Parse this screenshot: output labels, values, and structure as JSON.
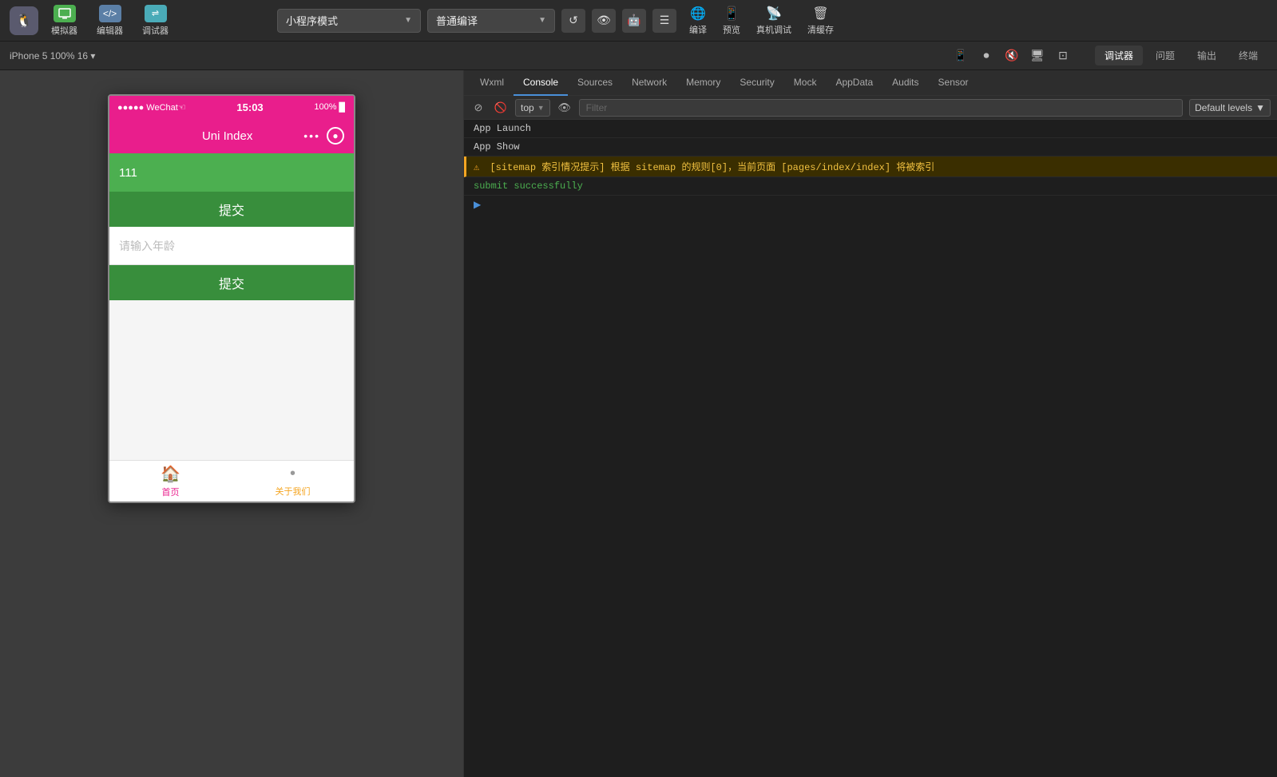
{
  "toolbar": {
    "logo_alt": "WeChat DevTools",
    "simulator_label": "模拟器",
    "editor_label": "编辑器",
    "debugger_label": "调试器",
    "mode_label": "小程序模式",
    "compile_label": "普通编译",
    "translate_label": "编译",
    "preview_label": "预览",
    "real_device_label": "真机调试",
    "clear_cache_label": "清缓存"
  },
  "secondary_toolbar": {
    "device_info": "iPhone 5  100%  16 ▾",
    "tabs": [
      {
        "label": "调试器",
        "active": true
      },
      {
        "label": "问题",
        "active": false
      },
      {
        "label": "输出",
        "active": false
      },
      {
        "label": "终端",
        "active": false
      }
    ]
  },
  "phone": {
    "signal": "●●●●● WeChat☜",
    "time": "15:03",
    "battery": "100%",
    "title": "Uni Index",
    "input_value": "111",
    "submit1_label": "提交",
    "placeholder": "请输入年龄",
    "submit2_label": "提交",
    "tab_home_label": "首页",
    "tab_about_label": "关于我们"
  },
  "devtools": {
    "tabs": [
      {
        "label": "Wxml",
        "active": false
      },
      {
        "label": "Console",
        "active": true
      },
      {
        "label": "Sources",
        "active": false
      },
      {
        "label": "Network",
        "active": false
      },
      {
        "label": "Memory",
        "active": false
      },
      {
        "label": "Security",
        "active": false
      },
      {
        "label": "Mock",
        "active": false
      },
      {
        "label": "AppData",
        "active": false
      },
      {
        "label": "Audits",
        "active": false
      },
      {
        "label": "Sensor",
        "active": false
      }
    ],
    "top_select": "top",
    "filter_placeholder": "Filter",
    "levels_label": "Default levels",
    "console_items": [
      {
        "type": "info",
        "text": "App Launch"
      },
      {
        "type": "info",
        "text": "App Show"
      },
      {
        "type": "warning",
        "text": "[sitemap 索引情况提示] 根据 sitemap 的规则[0]，当前页面 [pages/index/index] 将被索引"
      },
      {
        "type": "success",
        "text": "submit successfully"
      }
    ]
  }
}
